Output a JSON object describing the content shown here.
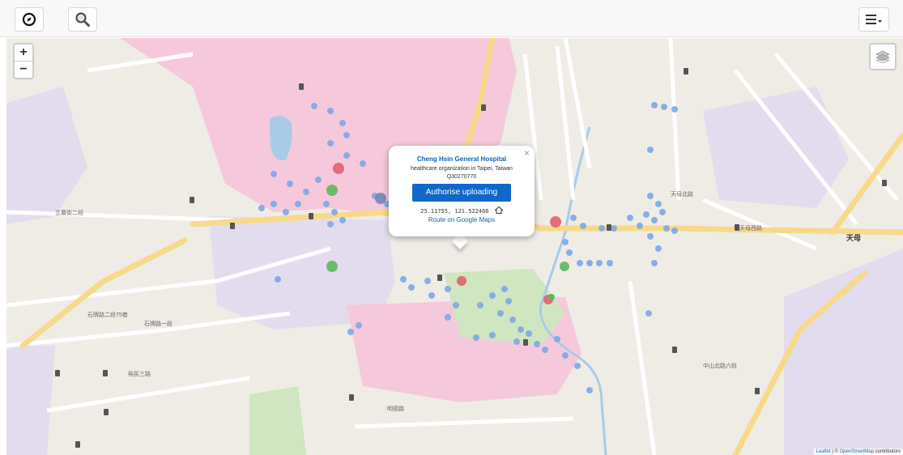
{
  "toolbar": {
    "compass_icon": "compass-icon",
    "search_icon": "search-icon",
    "menu_icon": "hamburger-menu-icon"
  },
  "map": {
    "zoom_in": "+",
    "zoom_out": "−",
    "attribution": {
      "leaflet": "Leaflet",
      "sep": " | © ",
      "osm": "OpenStreetMap",
      "contributors": " contributors"
    },
    "district_label": "天母",
    "street_labels": [
      "立農街二段",
      "石牌路二段75巷",
      "石牌路一段",
      "明德路",
      "天母西路",
      "天母北路",
      "中山北路六段",
      "裕民三路"
    ],
    "colors": {
      "hospital_zone": "#f6c8dc",
      "school_zone": "#e3dcef",
      "park": "#cfe6c0",
      "major_road": "#f7d98a",
      "water": "#a9cbe6",
      "dot_blue": "#7fa8e6",
      "dot_red": "#e0606f",
      "dot_green": "#5cb85c",
      "button_blue": "#0f68c8"
    }
  },
  "popup": {
    "close": "×",
    "title": "Cheng Hsin General Hospital",
    "subtitle": "healthcare organization in Taipei, Taiwan",
    "qid": "Q30270770",
    "button": "Authorise uploading",
    "coords": "25.11755, 121.522466",
    "route": "Route on Google Maps"
  }
}
